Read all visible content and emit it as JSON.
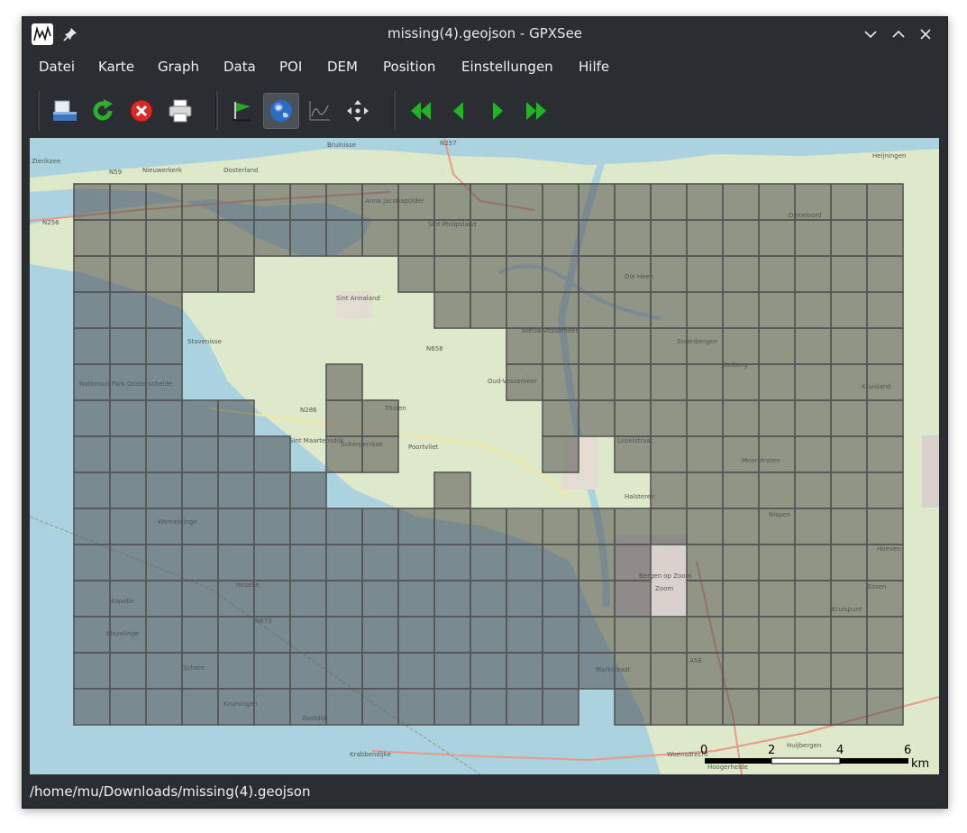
{
  "window": {
    "title": "missing(4).geojson - GPXSee"
  },
  "titlebar_icons": {
    "app": "gpxsee-app-icon",
    "pin": "pin-icon",
    "minimize": "chevron-down-icon",
    "maximize": "chevron-up-icon",
    "close": "close-icon"
  },
  "menu": {
    "items": [
      "Datei",
      "Karte",
      "Graph",
      "Data",
      "POI",
      "DEM",
      "Position",
      "Einstellungen",
      "Hilfe"
    ]
  },
  "toolbar": {
    "buttons": [
      {
        "name": "open-file-button",
        "icon": "open-file-icon"
      },
      {
        "name": "reload-button",
        "icon": "reload-icon"
      },
      {
        "name": "close-file-button",
        "icon": "close-file-icon"
      },
      {
        "name": "print-button",
        "icon": "printer-icon"
      },
      {
        "name": "show-poi-button",
        "icon": "flag-icon"
      },
      {
        "name": "show-map-button",
        "icon": "globe-icon",
        "active": true
      },
      {
        "name": "show-graphs-button",
        "icon": "graph-icon"
      },
      {
        "name": "show-position-button",
        "icon": "move-arrows-icon"
      },
      {
        "name": "first-file-button",
        "icon": "double-left-arrow-icon"
      },
      {
        "name": "previous-file-button",
        "icon": "left-arrow-icon"
      },
      {
        "name": "next-file-button",
        "icon": "right-arrow-icon"
      },
      {
        "name": "last-file-button",
        "icon": "double-right-arrow-icon"
      }
    ]
  },
  "map": {
    "labels": [
      "Zierikzee",
      "N59",
      "Nieuwerkerk",
      "Oosterland",
      "Bruinisse",
      "N257",
      "N256",
      "Anna Jacobapolder",
      "Sint Philipsland",
      "Sint Annaland",
      "Stavenisse",
      "N658",
      "Nationaal Park Oosterschelde",
      "Nieuw-Vossemeer",
      "Steenbergen",
      "Oud-Vossemeer",
      "N286",
      "Tholen",
      "Sint Maartensdijk",
      "Scherpenisse",
      "Poortvliet",
      "Halsteren",
      "Bergen op Zoom",
      "Wemeldinge",
      "Yerseke",
      "N673",
      "Kapelle",
      "Biezelinge",
      "Schore",
      "Kruiningen",
      "Oostdijk",
      "Markiezaat",
      "A58",
      "Woensdrecht",
      "Hoogerheide",
      "Huijbergen",
      "Krabbendijke",
      "Kruisland",
      "Welberg",
      "Heijningen",
      "Dinteloord",
      "Die Heen",
      "Lepelstraat",
      "Moerstraten",
      "Zoom",
      "Nispen",
      "Essen",
      "Hoeven",
      "Kruispunt"
    ],
    "grid_color": "#555555",
    "tile_fill": "rgba(80,80,80,0.55)"
  },
  "scale": {
    "ticks": [
      "0",
      "2",
      "4",
      "6"
    ],
    "unit": "km"
  },
  "status": {
    "path": "/home/mu/Downloads/missing(4).geojson"
  },
  "colors": {
    "window_bg": "#2a2e32",
    "text": "#eff0f1",
    "water": "#aad3df",
    "land": "#dde9c8"
  }
}
